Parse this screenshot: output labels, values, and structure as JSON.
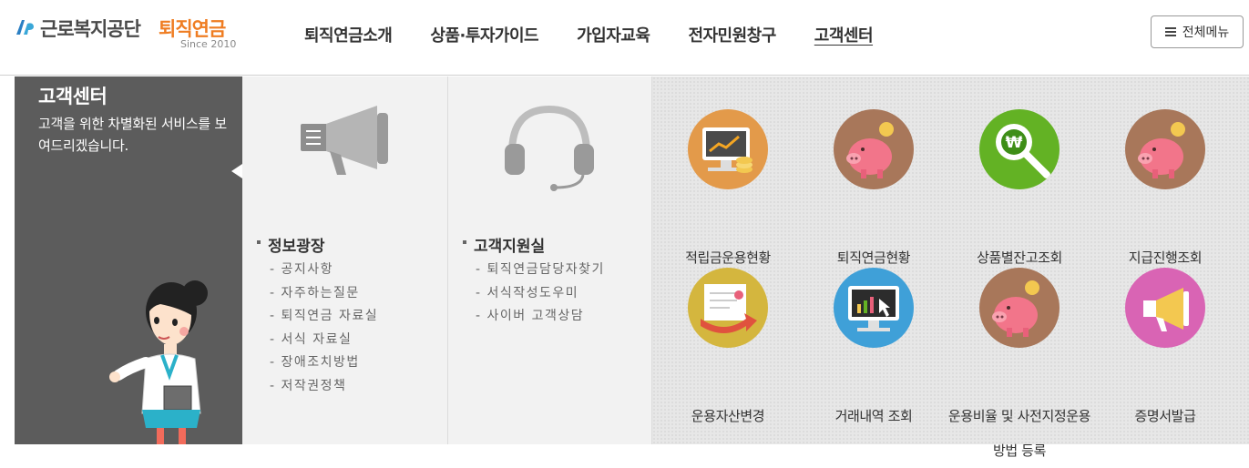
{
  "header": {
    "logo_org": "근로복지공단",
    "logo_brand": "퇴직연금",
    "logo_since": "Since 2010",
    "nav": [
      "퇴직연금소개",
      "상품·투자가이드",
      "가입자교육",
      "전자민원창구",
      "고객센터"
    ],
    "all_menu_label": "전체메뉴"
  },
  "left_panel": {
    "title": "고객센터",
    "description": "고객을 위한 차별화된 서비스를 보여드리겠습니다."
  },
  "info_plaza": {
    "heading": "정보광장",
    "items": [
      "- 공지사항",
      "- 자주하는질문",
      "- 퇴직연금 자료실",
      "- 서식 자료실",
      "- 장애조치방법",
      "- 저작권정책"
    ]
  },
  "support": {
    "heading": "고객지원실",
    "items": [
      "- 퇴직연금담당자찾기",
      "- 서식작성도우미",
      "- 사이버 고객상담"
    ]
  },
  "tiles": [
    {
      "label": "적립금운용현황",
      "icon": "monitor-chart-icon",
      "color": "#e39a4a"
    },
    {
      "label": "퇴직연금현황",
      "icon": "piggy-bank-icon",
      "color": "#a8775a"
    },
    {
      "label": "상품별잔고조회",
      "icon": "won-search-icon",
      "color": "#63b224"
    },
    {
      "label": "지급진행조회",
      "icon": "piggy-bank-icon",
      "color": "#a8775a"
    },
    {
      "label": "운용자산변경",
      "icon": "document-arrow-icon",
      "color": "#d4b63e"
    },
    {
      "label": "거래내역 조회",
      "icon": "monitor-cursor-icon",
      "color": "#3fa0d8"
    },
    {
      "label": "운용비율 및 사전지정운용 방법 등록",
      "icon": "piggy-bank-icon",
      "color": "#a8775a"
    },
    {
      "label": "증명서발급",
      "icon": "megaphone-icon",
      "color": "#d964b4"
    }
  ]
}
